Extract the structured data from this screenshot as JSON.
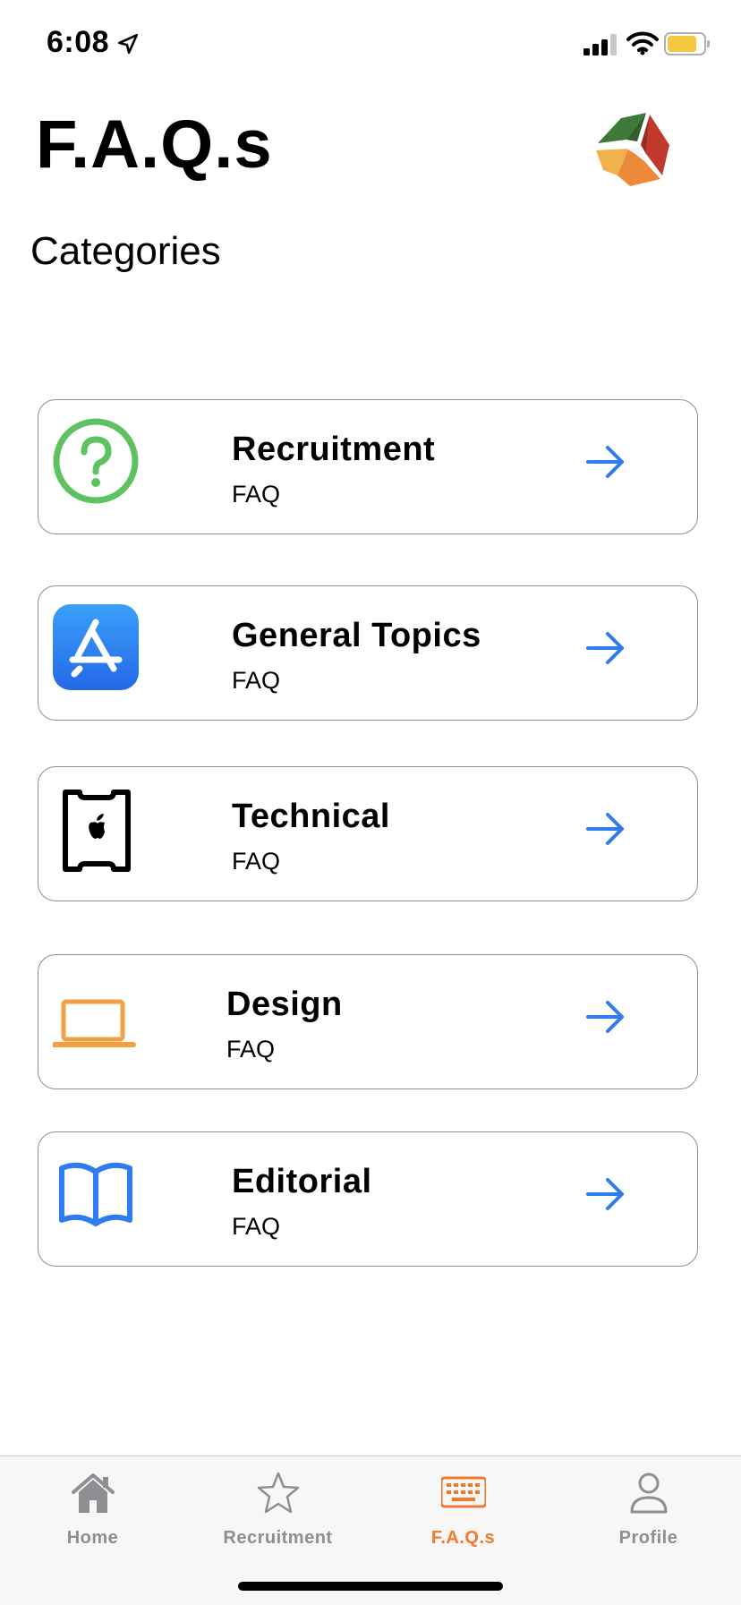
{
  "status": {
    "time": "6:08"
  },
  "header": {
    "title": "F.A.Q.s",
    "subtitle": "Categories"
  },
  "categories": [
    {
      "name": "Recruitment",
      "sub": "FAQ",
      "icon": "question-circle-icon"
    },
    {
      "name": "General Topics",
      "sub": "FAQ",
      "icon": "app-store-icon"
    },
    {
      "name": "Technical",
      "sub": "FAQ",
      "icon": "apple-ticket-icon"
    },
    {
      "name": "Design",
      "sub": "FAQ",
      "icon": "laptop-icon"
    },
    {
      "name": "Editorial",
      "sub": "FAQ",
      "icon": "book-icon"
    }
  ],
  "tabbar": {
    "items": [
      {
        "label": "Home",
        "icon": "home-icon"
      },
      {
        "label": "Recruitment",
        "icon": "star-icon"
      },
      {
        "label": "F.A.Q.s",
        "icon": "keyboard-icon",
        "active": true
      },
      {
        "label": "Profile",
        "icon": "person-icon"
      }
    ]
  },
  "colors": {
    "accent": "#f07a2b",
    "arrow": "#2f7bf0",
    "green": "#5ec262",
    "blue": "#2f7bf0",
    "orange": "#f0a040"
  }
}
